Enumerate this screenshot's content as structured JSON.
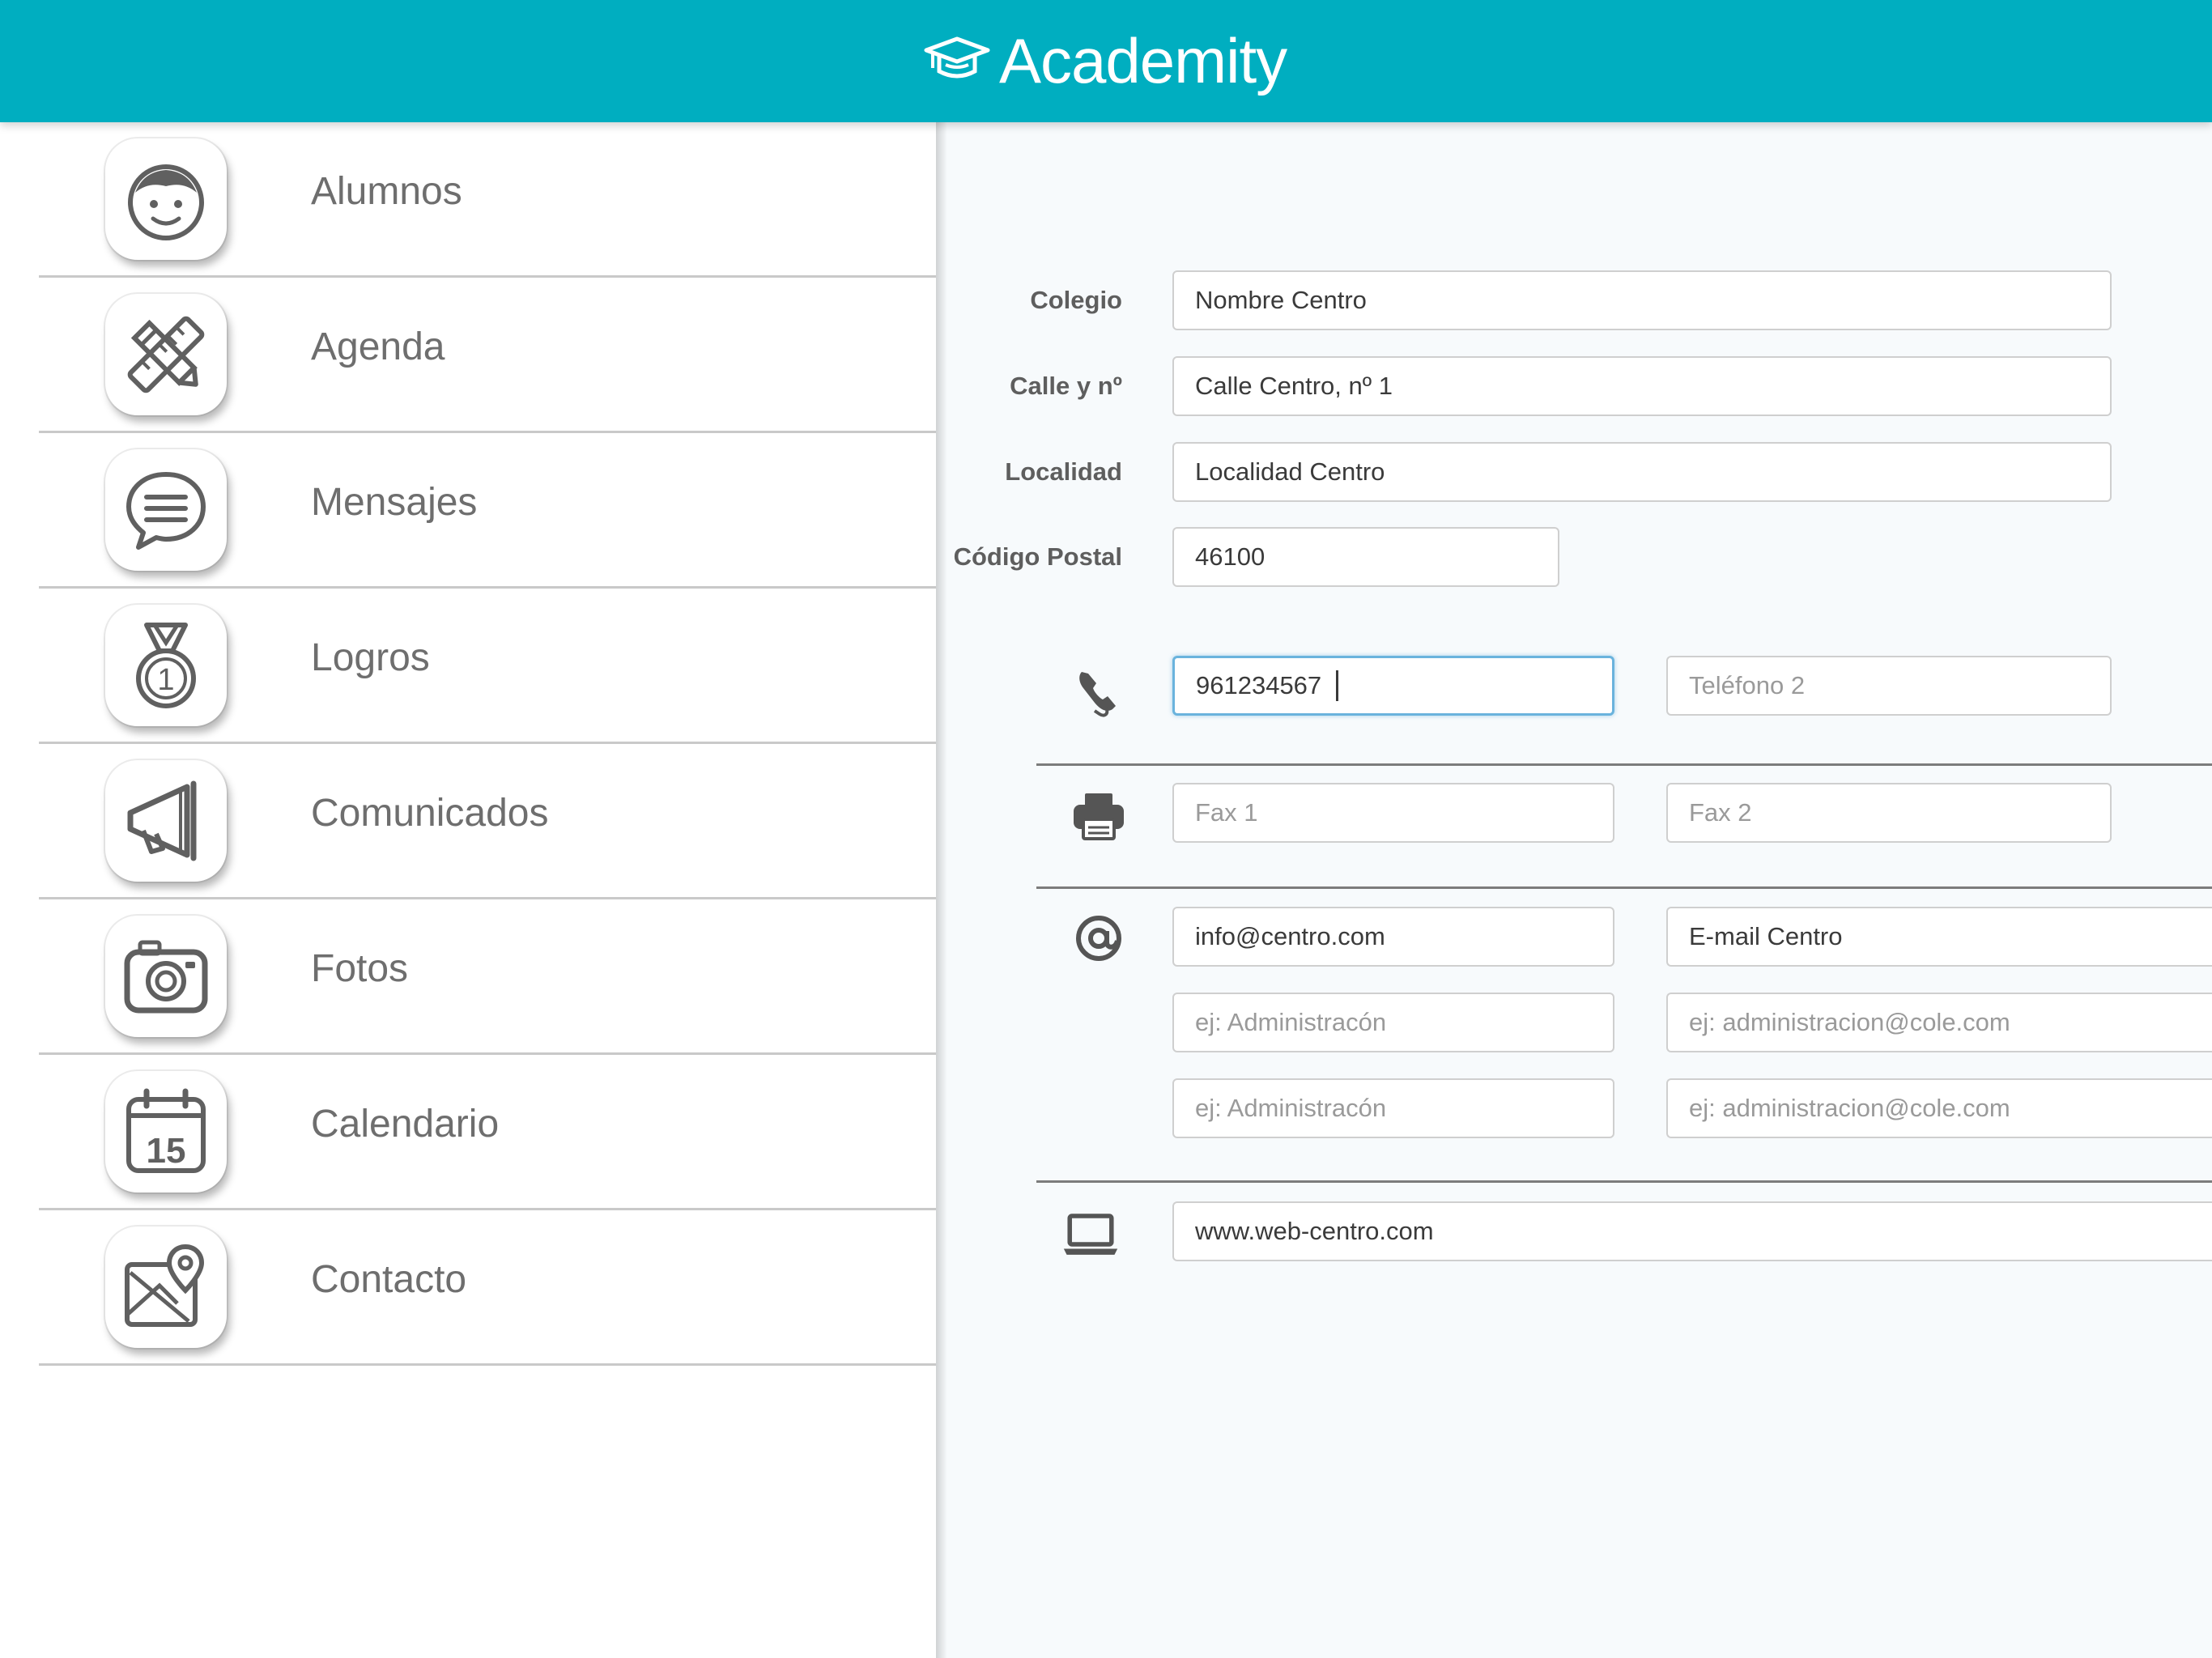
{
  "header": {
    "brand": "Academity",
    "color": "#00aec0"
  },
  "sidebar": {
    "items": [
      {
        "label": "Alumnos",
        "icon": "student-face-icon"
      },
      {
        "label": "Agenda",
        "icon": "pencil-ruler-icon"
      },
      {
        "label": "Mensajes",
        "icon": "speech-bubble-icon"
      },
      {
        "label": "Logros",
        "icon": "medal-icon"
      },
      {
        "label": "Comunicados",
        "icon": "megaphone-icon"
      },
      {
        "label": "Fotos",
        "icon": "camera-icon"
      },
      {
        "label": "Calendario",
        "icon": "calendar-icon"
      },
      {
        "label": "Contacto",
        "icon": "map-pin-icon"
      }
    ],
    "calendar_day": "15",
    "medal_number": "1"
  },
  "form": {
    "colegio": {
      "label": "Colegio",
      "value": "Nombre Centro"
    },
    "calle": {
      "label": "Calle y nº",
      "value": "Calle Centro, nº 1"
    },
    "localidad": {
      "label": "Localidad",
      "value": "Localidad Centro"
    },
    "codigo_postal": {
      "label": "Código Postal",
      "value": "46100"
    },
    "telefono1": {
      "value": "961234567"
    },
    "telefono2": {
      "placeholder": "Teléfono 2"
    },
    "fax1": {
      "placeholder": "Fax 1"
    },
    "fax2": {
      "placeholder": "Fax 2"
    },
    "emails": [
      {
        "name": "info@centro.com",
        "address": "E-mail Centro"
      },
      {
        "name_placeholder": "ej: Administracón",
        "address_placeholder": "ej: administracion@cole.com"
      },
      {
        "name_placeholder": "ej: Administracón",
        "address_placeholder": "ej: administracion@cole.com"
      }
    ],
    "web": {
      "value": "www.web-centro.com"
    }
  }
}
